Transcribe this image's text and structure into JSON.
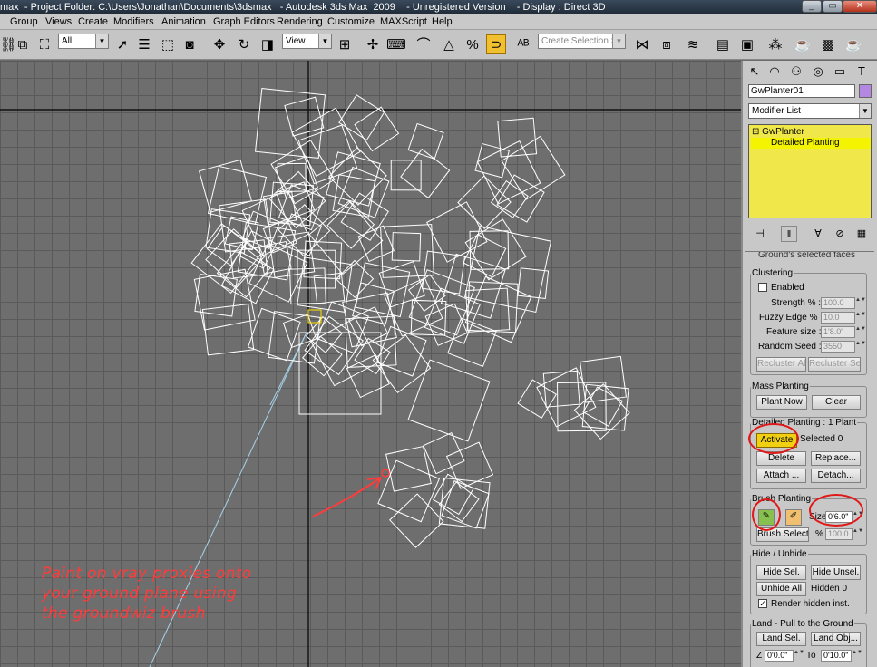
{
  "window": {
    "title": "max  - Project Folder: C:\\Users\\Jonathan\\Documents\\3dsmax   - Autodesk 3ds Max  2009    - Unregistered Version    - Display : Direct 3D",
    "buttons": [
      "_",
      "▭",
      "✕"
    ]
  },
  "menubar": {
    "items": [
      "Group",
      "Views",
      "Create",
      "Modifiers",
      "Animation",
      "Graph Editors",
      "Rendering",
      "Customize",
      "MAXScript",
      "Help"
    ]
  },
  "toolbar": {
    "filter_value": "All",
    "ref_coord_value": "View",
    "selection_set_placeholder": "Create Selection Se"
  },
  "viewport": {
    "annotation": "Paint on vray proxies onto\nyour ground plane using\nthe groundwiz brush",
    "colors": {
      "geometry": "#ffffff",
      "annotation": "#ff3b3b",
      "helper": "#ffe000",
      "light": "#a7d2ea"
    }
  },
  "command_panel": {
    "object_name": "GwPlanter01",
    "object_color": "#b487e0",
    "modifier_list": "Modifier List",
    "stack": {
      "base": "GwPlanter",
      "sub": "Detailed Planting"
    },
    "partial_top": "Ground's selected faces",
    "clustering": {
      "title": "Clustering",
      "enabled_label": "Enabled",
      "strength_label": "Strength % :",
      "strength_value": "100.0",
      "fuzzy_label": "Fuzzy Edge % :",
      "fuzzy_value": "10.0",
      "feature_label": "Feature size :",
      "feature_value": "1'8.0\"",
      "seed_label": "Random Seed :",
      "seed_value": "3550",
      "recluster_all": "Recluster All",
      "recluster_sel": "Recluster Sel"
    },
    "mass_planting": {
      "title": "Mass Planting",
      "plant_now": "Plant Now",
      "clear": "Clear"
    },
    "detailed_planting": {
      "title": "Detailed Planting : 1 Plant",
      "activate": "Activate",
      "selected": "Selected 0",
      "delete": "Delete",
      "replace": "Replace...",
      "attach": "Attach ...",
      "detach": "Detach..."
    },
    "brush_planting": {
      "title": "Brush Planting",
      "size_label": "Size",
      "size_value": "0'6.0\"",
      "brush_select": "Brush Select",
      "pct_label": "%",
      "pct_value": "100.0"
    },
    "hide_unhide": {
      "title": "Hide / Unhide",
      "hide_sel": "Hide Sel.",
      "hide_unsel": "Hide Unsel.",
      "unhide_all": "Unhide All",
      "hidden": "Hidden 0",
      "render_hidden": "Render hidden inst."
    },
    "land": {
      "title": "Land - Pull to the Ground",
      "land_sel": "Land Sel.",
      "land_obj": "Land Obj...",
      "z_label": "Z",
      "z_value": "0'0.0\"",
      "to_label": "To",
      "to_value": "0'10.0\""
    }
  }
}
